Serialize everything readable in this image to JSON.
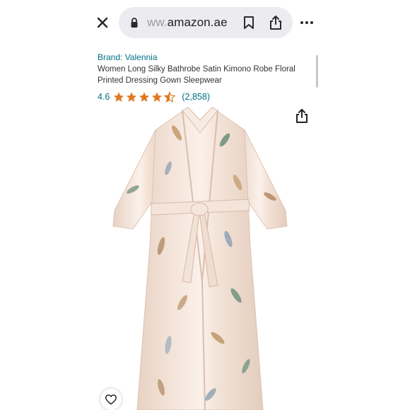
{
  "browser": {
    "url_faded": "ww.",
    "url_main": "amazon.ae"
  },
  "product": {
    "brand": "Brand: Valennia",
    "title": "Women Long Silky Bathrobe Satin Kimono Robe Floral Printed Dressing Gown Sleepwear",
    "rating": "4.6",
    "stars_filled": 4.5,
    "review_count": "(2,858)"
  },
  "colors": {
    "link": "#007185",
    "star": "#de7921",
    "robe": "#f1dfd3"
  },
  "icons": [
    "close-icon",
    "lock-icon",
    "bookmark-icon",
    "share-icon",
    "more-icon",
    "star-icon",
    "heart-icon"
  ]
}
